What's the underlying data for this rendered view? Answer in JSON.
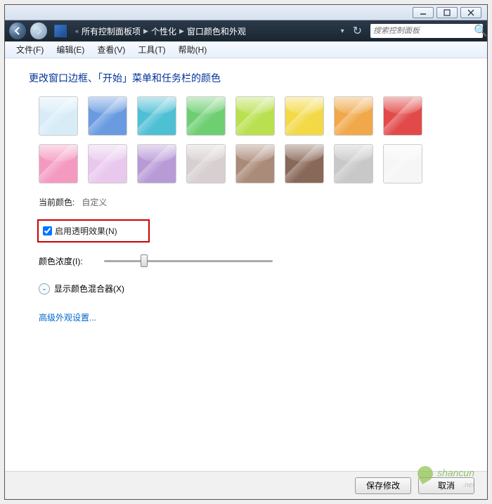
{
  "window_controls": {
    "min": "minimize",
    "max": "maximize",
    "close": "close"
  },
  "breadcrumb": {
    "items": [
      "所有控制面板项",
      "个性化",
      "窗口颜色和外观"
    ]
  },
  "search": {
    "placeholder": "搜索控制面板"
  },
  "menu": {
    "items": [
      "文件(F)",
      "编辑(E)",
      "查看(V)",
      "工具(T)",
      "帮助(H)"
    ]
  },
  "page": {
    "title": "更改窗口边框、「开始」菜单和任务栏的颜色"
  },
  "colors": [
    "#d8ecf7",
    "#6a9be0",
    "#4ec0d4",
    "#6ecf72",
    "#b9e04f",
    "#f3d948",
    "#f0a84a",
    "#e24a4a",
    "#f49ac1",
    "#e9c8ee",
    "#b89ad6",
    "#d8d0d0",
    "#aa8a78",
    "#886858",
    "#c8c8c8",
    "#f6f6f6"
  ],
  "current_color": {
    "label": "当前颜色:",
    "value": "自定义"
  },
  "transparency": {
    "label": "启用透明效果(N)",
    "checked": true
  },
  "intensity": {
    "label": "颜色浓度(I):",
    "value": 22
  },
  "mixer": {
    "label": "显示颜色混合器(X)"
  },
  "advanced_link": "高级外观设置...",
  "footer": {
    "save": "保存修改",
    "cancel": "取消"
  },
  "watermark": "shancun"
}
